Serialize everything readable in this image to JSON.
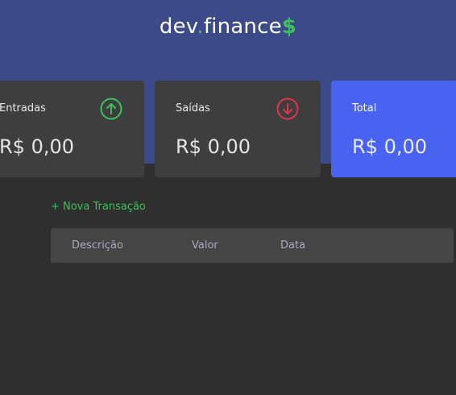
{
  "header": {
    "logo_prefix": "dev",
    "logo_dot": ".",
    "logo_main": "finance",
    "logo_suffix": "$"
  },
  "cards": {
    "income": {
      "label": "Entradas",
      "value": "R$ 0,00",
      "icon": "arrow-up-circle-icon"
    },
    "expense": {
      "label": "Saídas",
      "value": "R$ 0,00",
      "icon": "arrow-down-circle-icon"
    },
    "total": {
      "label": "Total",
      "value": "R$ 0,00"
    }
  },
  "actions": {
    "new_transaction": "+ Nova Transação"
  },
  "table": {
    "columns": [
      "Descrição",
      "Valor",
      "Data"
    ]
  },
  "colors": {
    "header_bg": "#3d4a8a",
    "page_bg": "#2f2f2f",
    "card_bg": "#3e3e3e",
    "total_bg": "#4a62f0",
    "income_green": "#3dbf5a",
    "expense_red": "#e0354a"
  }
}
